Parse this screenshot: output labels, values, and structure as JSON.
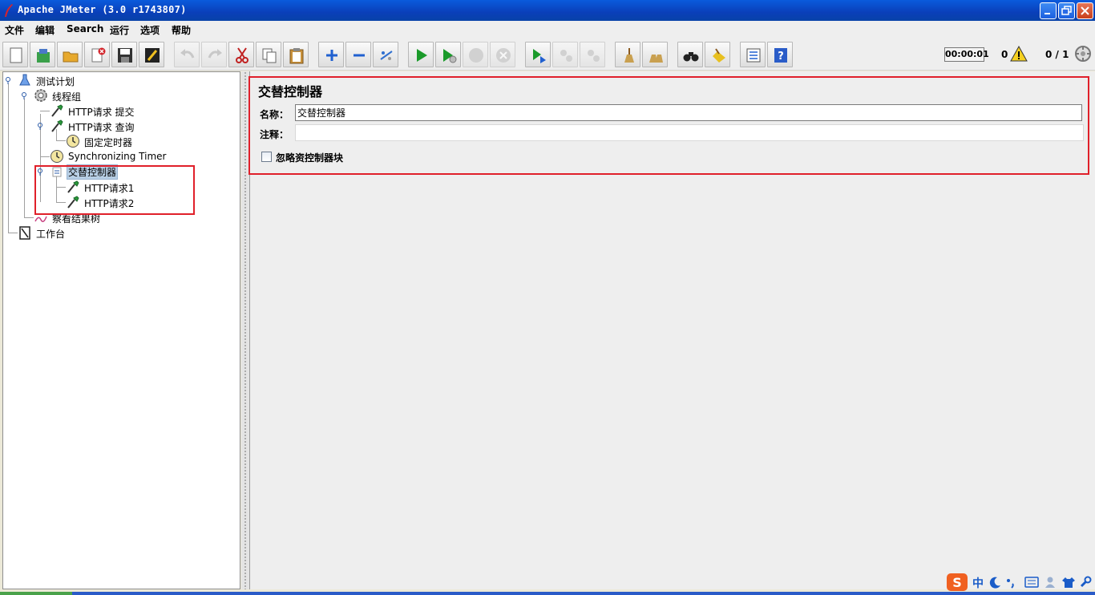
{
  "window": {
    "title": "Apache JMeter (3.0 r1743807)"
  },
  "menu": [
    "文件",
    "编辑",
    "Search",
    "运行",
    "选项",
    "帮助"
  ],
  "status": {
    "elapsed": "00:00:01",
    "errors": "0",
    "threads": "0 / 1"
  },
  "tree": [
    {
      "label": "测试计划",
      "icon": "test-plan-icon"
    },
    {
      "label": "线程组",
      "icon": "gear-icon"
    },
    {
      "label": "HTTP请求 提交",
      "icon": "dropper-icon"
    },
    {
      "label": "HTTP请求 查询",
      "icon": "dropper-icon"
    },
    {
      "label": "固定定时器",
      "icon": "clock-icon"
    },
    {
      "label": "Synchronizing Timer",
      "icon": "clock-icon"
    },
    {
      "label": "交替控制器",
      "icon": "controller-icon",
      "selected": true
    },
    {
      "label": "HTTP请求1",
      "icon": "dropper-icon"
    },
    {
      "label": "HTTP请求2",
      "icon": "dropper-icon"
    },
    {
      "label": "察看结果树",
      "icon": "chart-icon"
    },
    {
      "label": "工作台",
      "icon": "workbench-icon"
    }
  ],
  "panel": {
    "title": "交替控制器",
    "name_label": "名称：",
    "name_value": "交替控制器",
    "comment_label": "注释：",
    "ignore_label": "忽略资控制器块"
  },
  "ime": {
    "lang": "中"
  },
  "colors": {
    "accent": "#0a4fcf",
    "selection": "#b8cfe5",
    "highlight_box": "#e0202a"
  }
}
